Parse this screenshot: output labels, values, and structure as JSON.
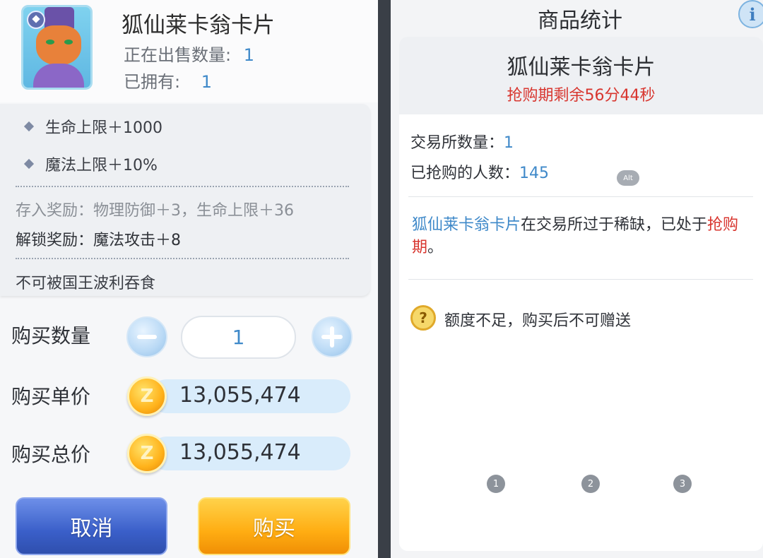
{
  "left": {
    "item_title": "狐仙莱卡翁卡片",
    "on_sale_label": "正在出售数量:",
    "on_sale_value": "1",
    "owned_label": "已拥有:",
    "owned_value": "1",
    "stats": [
      "生命上限＋1000",
      "魔法上限＋10%"
    ],
    "deposit_reward": "存入奖励：物理防御＋3，生命上限＋36",
    "unlock_reward": "解锁奖励：魔法攻击＋8",
    "restriction": "不可被国王波利吞食",
    "qty_label": "购买数量",
    "qty_value": "1",
    "unit_price_label": "购买单价",
    "unit_price": "13,055,474",
    "total_price_label": "购买总价",
    "total_price": "13,055,474",
    "coin_symbol": "Z",
    "cancel_label": "取消",
    "buy_label": "购买"
  },
  "right": {
    "title": "商品统计",
    "info_icon_text": "i",
    "item_name": "狐仙莱卡翁卡片",
    "countdown": "抢购期剩余56分44秒",
    "exchange_label": "交易所数量：",
    "exchange_value": "1",
    "buyers_label": "已抢购的人数：",
    "buyers_value": "145",
    "desc_item": "狐仙莱卡翁卡片",
    "desc_mid": "在交易所过于稀缺，已处于",
    "desc_period": "抢购期",
    "desc_end": "。",
    "warn_icon_text": "?",
    "warning": "额度不足，购买后不可赠送",
    "alt_badge": "Alt",
    "page_dots": [
      "1",
      "2",
      "3"
    ]
  },
  "colors": {
    "accent_blue": "#3f89c9",
    "alert_red": "#d8362f",
    "cancel_button": "#3a5fc9",
    "buy_button": "#ffad12"
  }
}
